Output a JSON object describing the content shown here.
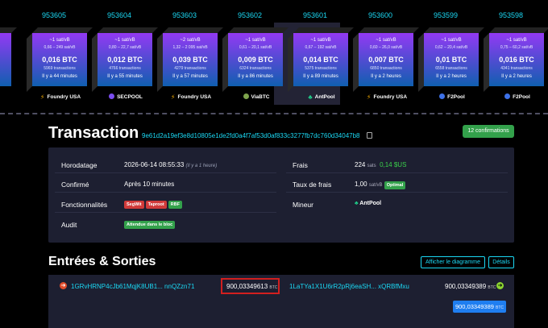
{
  "blocks": [
    {
      "height": "",
      "fee": "",
      "range": "",
      "btc": "",
      "txs": "",
      "ago": "",
      "pool": "",
      "icon": ""
    },
    {
      "height": "953605",
      "fee": "~1 sat/vB",
      "range": "0,66 – 249 sat/vB",
      "btc": "0,016 BTC",
      "txs": "5969 transactions",
      "ago": "Il y a 44 minutes",
      "pool": "Foundry USA",
      "icon": "bolt"
    },
    {
      "height": "953604",
      "fee": "~1 sat/vB",
      "range": "0,80 – 22,7 sat/vB",
      "btc": "0,012 BTC",
      "txs": "4766 transactions",
      "ago": "Il y a 55 minutes",
      "pool": "SECPOOL",
      "icon": "sec"
    },
    {
      "height": "953603",
      "fee": "~2 sat/vB",
      "range": "1,32 – 2 095 sat/vB",
      "btc": "0,039 BTC",
      "txs": "4279 transactions",
      "ago": "Il y a 57 minutes",
      "pool": "Foundry USA",
      "icon": "bolt"
    },
    {
      "height": "953602",
      "fee": "~1 sat/vB",
      "range": "0,61 – 20,1 sat/vB",
      "btc": "0,009 BTC",
      "txs": "6324 transactions",
      "ago": "Il y a 86 minutes",
      "pool": "ViaBTC",
      "icon": "via"
    },
    {
      "height": "953601",
      "fee": "~1 sat/vB",
      "range": "0,67 – 192 sat/vB",
      "btc": "0,014 BTC",
      "txs": "5375 transactions",
      "ago": "Il y a 89 minutes",
      "pool": "AntPool",
      "icon": "ant"
    },
    {
      "height": "953600",
      "fee": "~1 sat/vB",
      "range": "0,60 – 26,0 sat/vB",
      "btc": "0,007 BTC",
      "txs": "6850 transactions",
      "ago": "Il y a 2 heures",
      "pool": "Foundry USA",
      "icon": "bolt"
    },
    {
      "height": "953599",
      "fee": "~1 sat/vB",
      "range": "0,62 – 20,4 sat/vB",
      "btc": "0,01 BTC",
      "txs": "6558 transactions",
      "ago": "Il y a 2 heures",
      "pool": "F2Pool",
      "icon": "f2"
    },
    {
      "height": "953598",
      "fee": "~1 sat/vB",
      "range": "0,75 – 60,2 sat/vB",
      "btc": "0,016 BTC",
      "txs": "4341 transactions",
      "ago": "Il y a 2 heures",
      "pool": "F2Pool",
      "icon": "f2"
    }
  ],
  "tx": {
    "title": "Transaction",
    "hash": "9e61d2a19ef3e8d10805e1de2fd0a4f7af53d0af833c3277fb7dc760d34047b8",
    "confirmations": "12 confirmations"
  },
  "details": {
    "timestamp_label": "Horodatage",
    "timestamp_value": "2026-06-14 08:55:33",
    "timestamp_rel": "(Il y a 1 heure)",
    "confirmed_label": "Confirmé",
    "confirmed_value": "Après 10 minutes",
    "features_label": "Fonctionnalités",
    "features": [
      "SegWit",
      "Taproot",
      "RBF"
    ],
    "audit_label": "Audit",
    "audit_value": "Attendue dans le bloc",
    "fee_label": "Frais",
    "fee_sats": "224",
    "fee_sats_unit": "sats",
    "fee_usd": "0,14 $US",
    "rate_label": "Taux de frais",
    "rate_value": "1,00",
    "rate_unit": "sat/vB",
    "rate_badge": "Optimal",
    "miner_label": "Mineur",
    "miner_value": "AntPool"
  },
  "io": {
    "title": "Entrées & Sorties",
    "diagram_button": "Afficher le diagramme",
    "details_button": "Détails",
    "input_address": "1GRvHRNP4cJb61MqjK8UB1... nnQZzn71",
    "input_amount": "900,03349613",
    "output_address": "1LaTYa1X1U6rR2pRj6eaSH... xQRBfMxu",
    "output_amount": "900,03349389",
    "total": "900,03349389",
    "unit": "BTC"
  },
  "colors": {
    "accent": "#1bd8f4",
    "confirm": "#33a14b",
    "highlight": "#d21f1f"
  }
}
